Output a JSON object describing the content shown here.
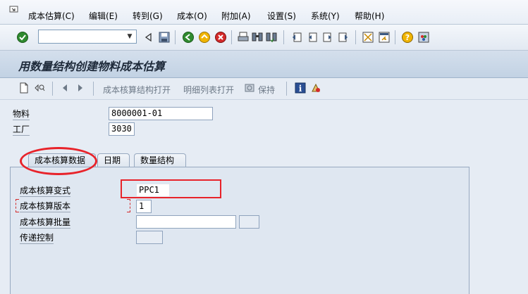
{
  "menu": {
    "items": [
      "成本估算(C)",
      "编辑(E)",
      "转到(G)",
      "成本(O)",
      "附加(A)",
      "设置(S)",
      "系统(Y)",
      "帮助(H)"
    ]
  },
  "toolbar": {
    "command_value": ""
  },
  "title": "用数量结构创建物料成本估算",
  "app_toolbar": {
    "structure_open": "成本核算结构打开",
    "itemization_open": "明细列表打开",
    "hold": "保持"
  },
  "header_fields": {
    "material_label": "物料",
    "material_value": "8000001-01",
    "plant_label": "工厂",
    "plant_value": "3030"
  },
  "tabs": [
    "成本核算数据",
    "日期",
    "数量结构"
  ],
  "costing_data": {
    "variant_label": "成本核算变式",
    "variant_value": "PPC1",
    "version_label": "成本核算版本",
    "version_value": "1",
    "lot_size_label": "成本核算批量",
    "lot_size_value": "",
    "lot_unit_value": "",
    "transfer_label": "传递控制",
    "transfer_value": ""
  },
  "colors": {
    "annotation_red": "#e8232a",
    "title_bg": "#c2d2e4"
  }
}
